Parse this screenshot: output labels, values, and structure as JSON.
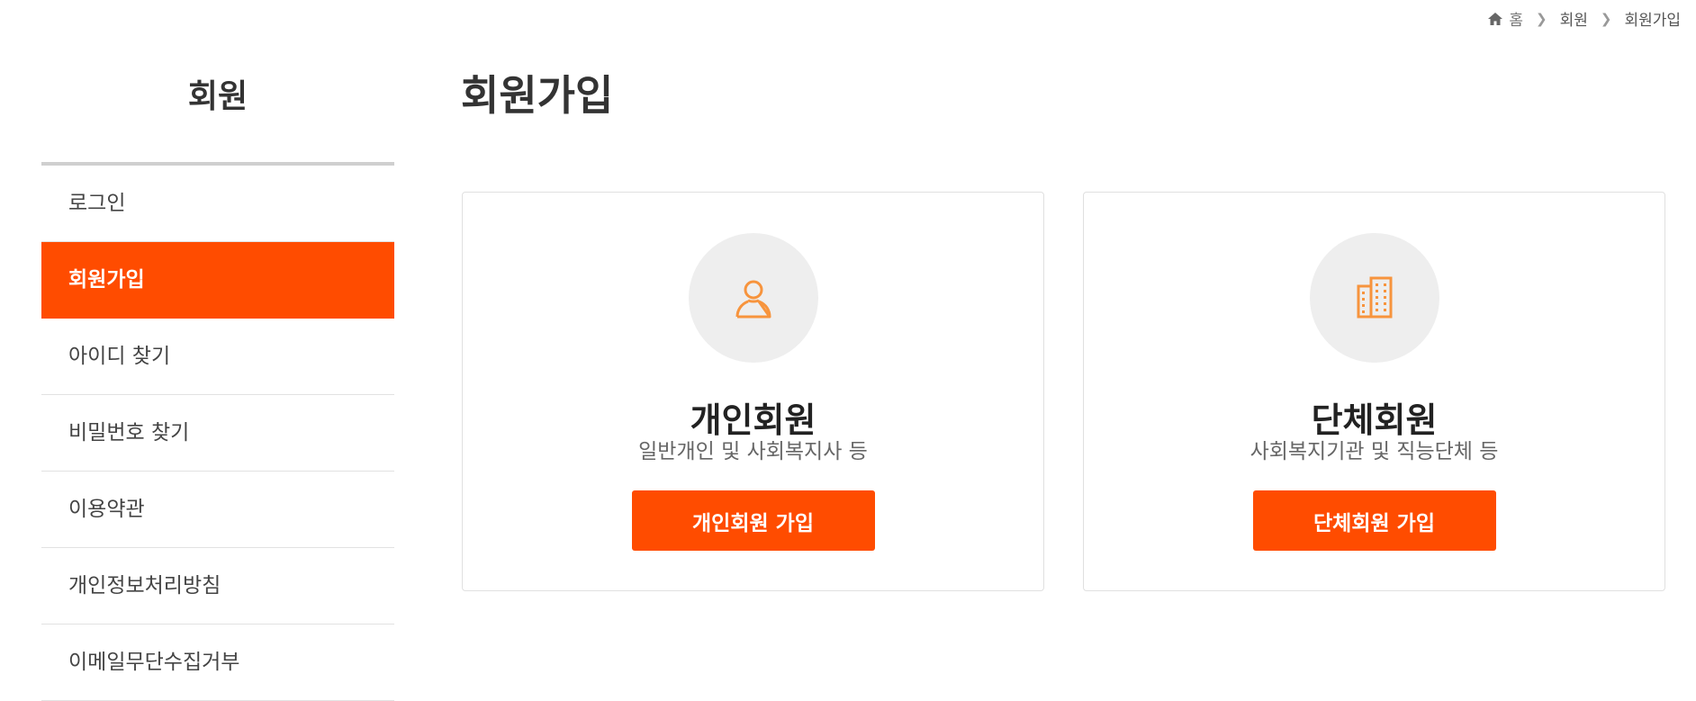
{
  "breadcrumb": {
    "home": "홈",
    "level1": "회원",
    "level2": "회원가입"
  },
  "sidebar": {
    "title": "회원",
    "items": [
      {
        "label": "로그인",
        "active": false
      },
      {
        "label": "회원가입",
        "active": true
      },
      {
        "label": "아이디 찾기",
        "active": false
      },
      {
        "label": "비밀번호 찾기",
        "active": false
      },
      {
        "label": "이용약관",
        "active": false
      },
      {
        "label": "개인정보처리방침",
        "active": false
      },
      {
        "label": "이메일무단수집거부",
        "active": false
      }
    ]
  },
  "main": {
    "title": "회원가입",
    "cards": [
      {
        "icon": "person-icon",
        "title": "개인회원",
        "description": "일반개인 및 사회복지사 등",
        "button": "개인회원 가입"
      },
      {
        "icon": "building-icon",
        "title": "단체회원",
        "description": "사회복지기관 및 직능단체 등",
        "button": "단체회원 가입"
      }
    ]
  },
  "colors": {
    "accent": "#ff4c00",
    "icon": "#f7943d",
    "circle_bg": "#eeeeee"
  }
}
